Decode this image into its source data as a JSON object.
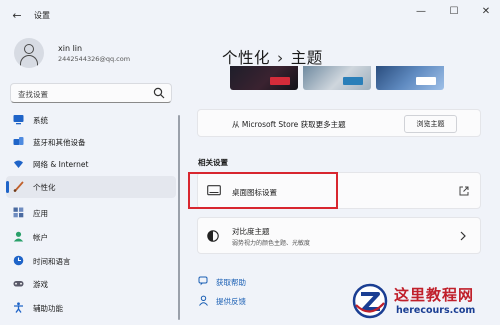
{
  "window": {
    "title": "设置",
    "controls": {
      "minimize": "—",
      "maximize": "☐",
      "close": "✕"
    },
    "back_glyph": "←"
  },
  "account": {
    "name": "xin lin",
    "email": "2442544326@qq.com"
  },
  "search": {
    "placeholder": "查找设置"
  },
  "sidebar": {
    "items": [
      {
        "label": "系统",
        "icon": "system-icon",
        "color": "#1f64c8"
      },
      {
        "label": "蓝牙和其他设备",
        "icon": "bluetooth-icon",
        "color": "#1f64c8"
      },
      {
        "label": "网络 & Internet",
        "icon": "network-icon",
        "color": "#1f64c8"
      },
      {
        "label": "个性化",
        "icon": "personalization-icon",
        "color": "#c0602b",
        "active": true
      },
      {
        "label": "应用",
        "icon": "apps-icon",
        "color": "#4a6aa0"
      },
      {
        "label": "帐户",
        "icon": "accounts-icon",
        "color": "#2aa06a"
      },
      {
        "label": "时间和语言",
        "icon": "time-language-icon",
        "color": "#1f64c8"
      },
      {
        "label": "游戏",
        "icon": "gaming-icon",
        "color": "#5a5a6a"
      },
      {
        "label": "辅助功能",
        "icon": "accessibility-icon",
        "color": "#1f64c8"
      }
    ]
  },
  "header": {
    "parent": "个性化",
    "separator": "›",
    "current": "主题"
  },
  "store": {
    "text": "从 Microsoft Store 获取更多主题",
    "button": "浏览主题"
  },
  "related": {
    "section_label": "相关设置",
    "desktop_icons": {
      "label": "桌面图标设置",
      "icon": "monitor-icon"
    },
    "contrast": {
      "label": "对比度主题",
      "subtitle": "弱势视力的颜色主题、光敏度",
      "icon": "contrast-icon"
    }
  },
  "links": {
    "help": "获取帮助",
    "feedback": "提供反馈"
  },
  "watermark": {
    "title": "这里教程网",
    "url": "herecours.com"
  },
  "colors": {
    "accent": "#1f64c8",
    "highlight_box": "#d8262f",
    "link": "#1a5fb4"
  }
}
